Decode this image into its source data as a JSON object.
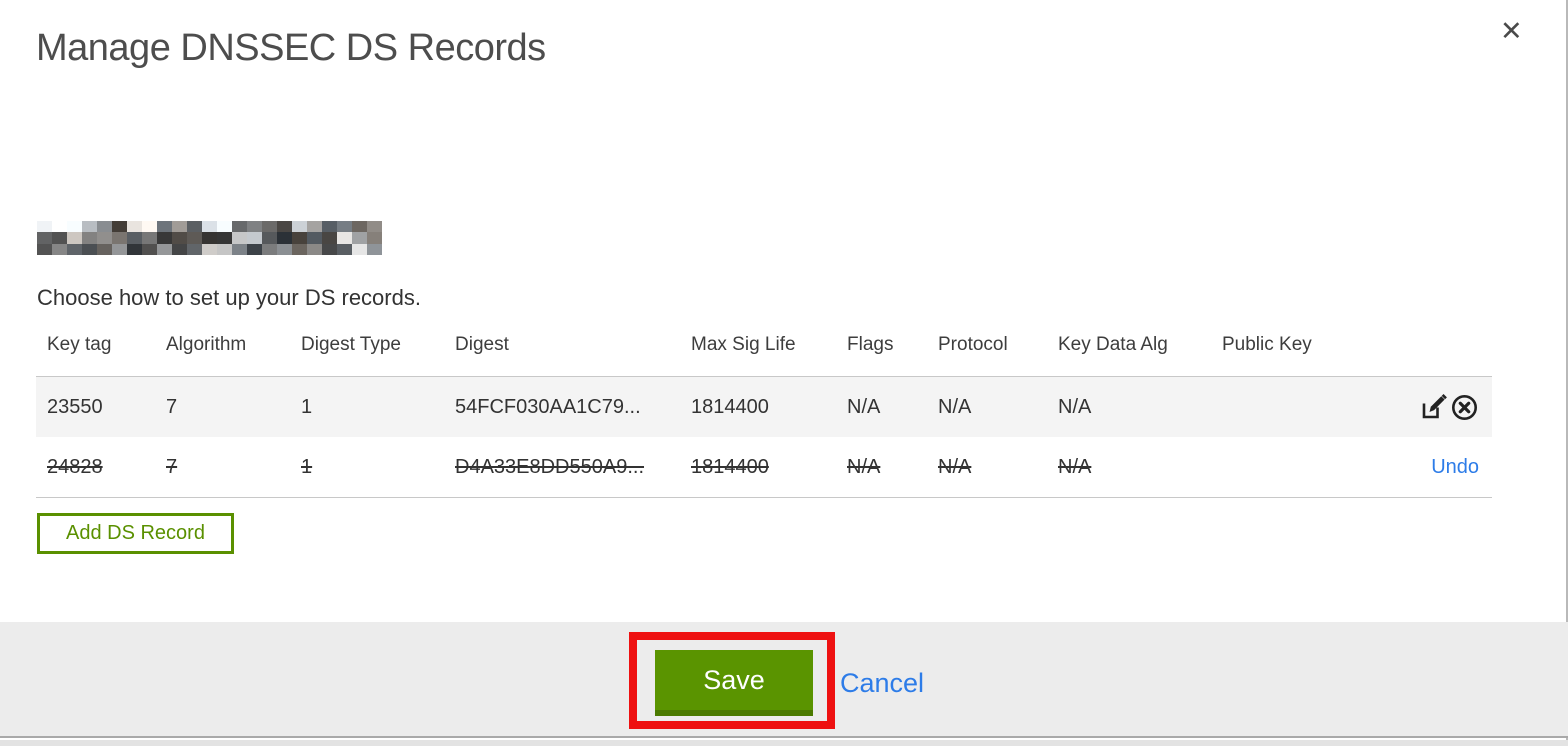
{
  "dialog": {
    "title": "Manage DNSSEC DS Records",
    "close_label": "✕",
    "instruction": "Choose how to set up your DS records.",
    "domain_redacted": true
  },
  "table": {
    "headers": {
      "key_tag": "Key tag",
      "algorithm": "Algorithm",
      "digest_type": "Digest Type",
      "digest": "Digest",
      "max_sig_life": "Max Sig Life",
      "flags": "Flags",
      "protocol": "Protocol",
      "key_data_alg": "Key Data Alg",
      "public_key": "Public Key"
    },
    "rows": [
      {
        "key_tag": "23550",
        "algorithm": "7",
        "digest_type": "1",
        "digest": "54FCF030AA1C79...",
        "max_sig_life": "1814400",
        "flags": "N/A",
        "protocol": "N/A",
        "key_data_alg": "N/A",
        "public_key": "",
        "state": "existing"
      },
      {
        "key_tag": "24828",
        "algorithm": "7",
        "digest_type": "1",
        "digest": "D4A33E8DD550A9...",
        "max_sig_life": "1814400",
        "flags": "N/A",
        "protocol": "N/A",
        "key_data_alg": "N/A",
        "public_key": "",
        "state": "deleted",
        "undo_label": "Undo"
      }
    ]
  },
  "buttons": {
    "add_record": "Add DS Record",
    "save": "Save",
    "cancel": "Cancel"
  },
  "colors": {
    "brand_green": "#5a9400",
    "brand_green_dark": "#4a7a00",
    "link_blue": "#2d7ce8",
    "annotation_red": "#ee1111",
    "footer_bg": "#ececec",
    "row_alt_bg": "#f4f4f4"
  }
}
